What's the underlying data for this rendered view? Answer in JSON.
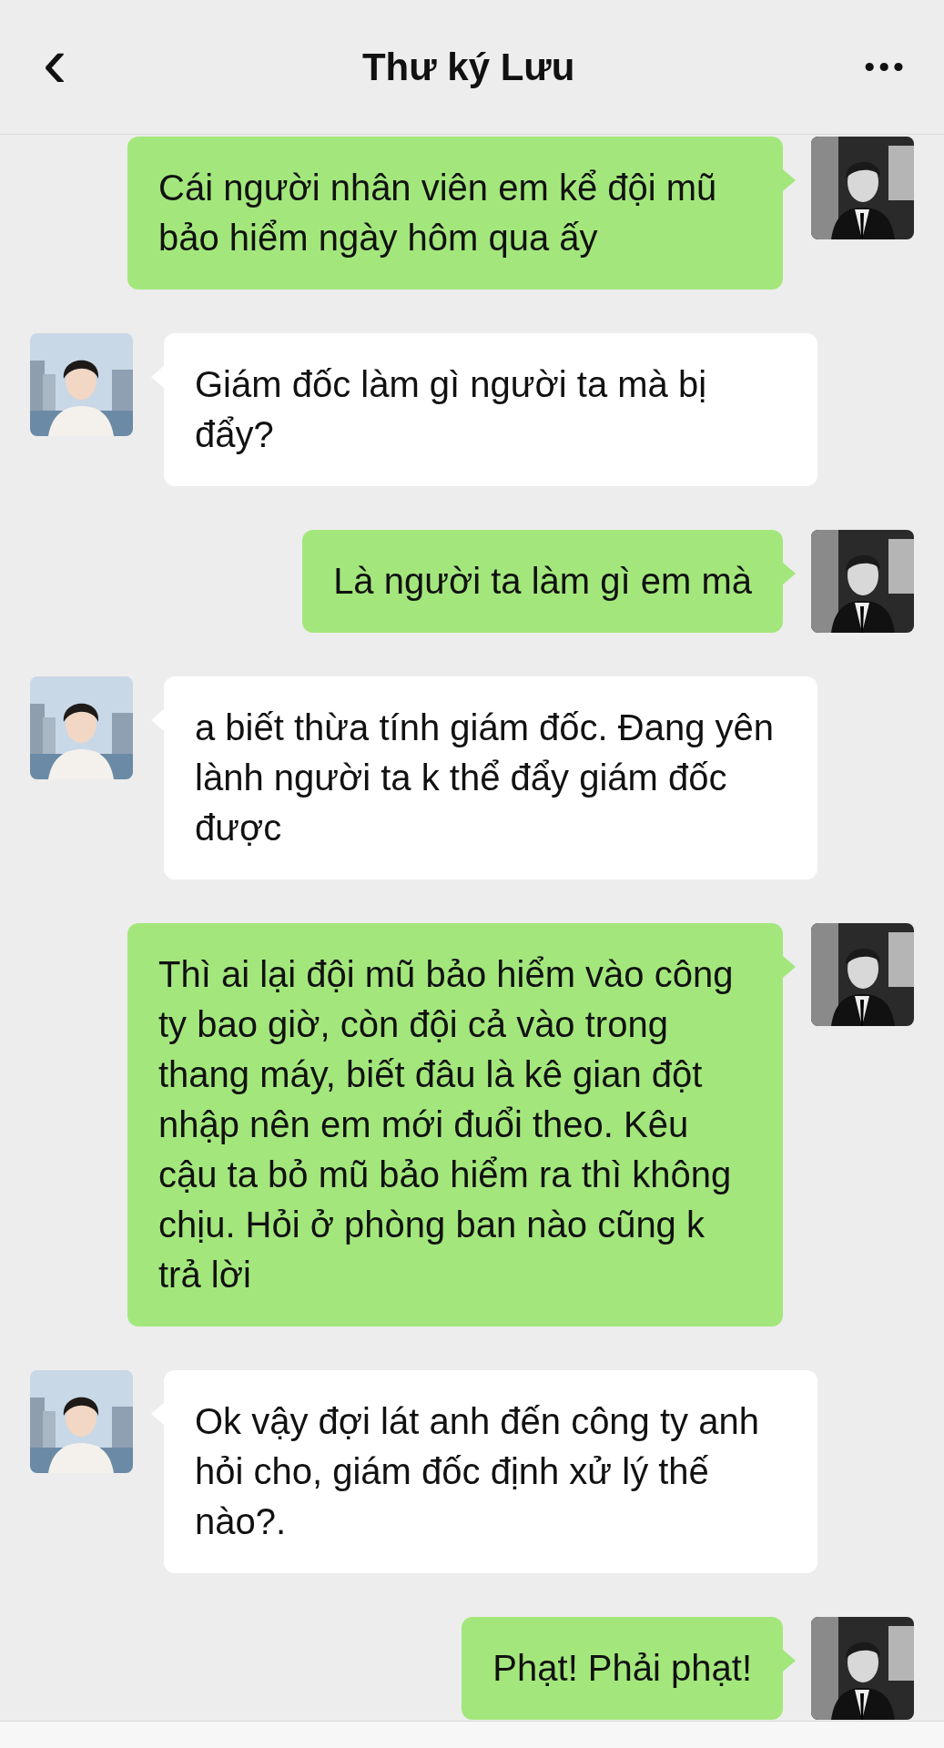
{
  "header": {
    "back": "‹",
    "title": "Thư ký Lưu",
    "more": "•••"
  },
  "messages": [
    {
      "kind": "outgoing",
      "text": "Cái người nhân viên em kể đội mũ bảo hiểm ngày hôm qua ấy"
    },
    {
      "kind": "incoming",
      "text": "Giám đốc làm gì người ta mà bị đẩy?"
    },
    {
      "kind": "outgoing",
      "text": "Là người ta làm gì em mà"
    },
    {
      "kind": "incoming",
      "text": "a biết thừa tính giám đốc. Đang yên lành người ta k thể đẩy giám đốc được"
    },
    {
      "kind": "outgoing",
      "text": "Thì ai lại đội mũ bảo hiểm vào công ty bao giờ, còn đội cả vào trong thang máy, biết đâu là kê gian đột nhập nên em mới đuổi theo. Kêu cậu ta bỏ mũ bảo hiểm ra thì không chịu. Hỏi ở phòng ban nào cũng k trả lời"
    },
    {
      "kind": "incoming",
      "text": "Ok vậy đợi lát anh đến công ty anh hỏi cho, giám đốc định xử lý thế nào?."
    },
    {
      "kind": "outgoing",
      "text": "Phạt! Phải phạt!"
    }
  ]
}
